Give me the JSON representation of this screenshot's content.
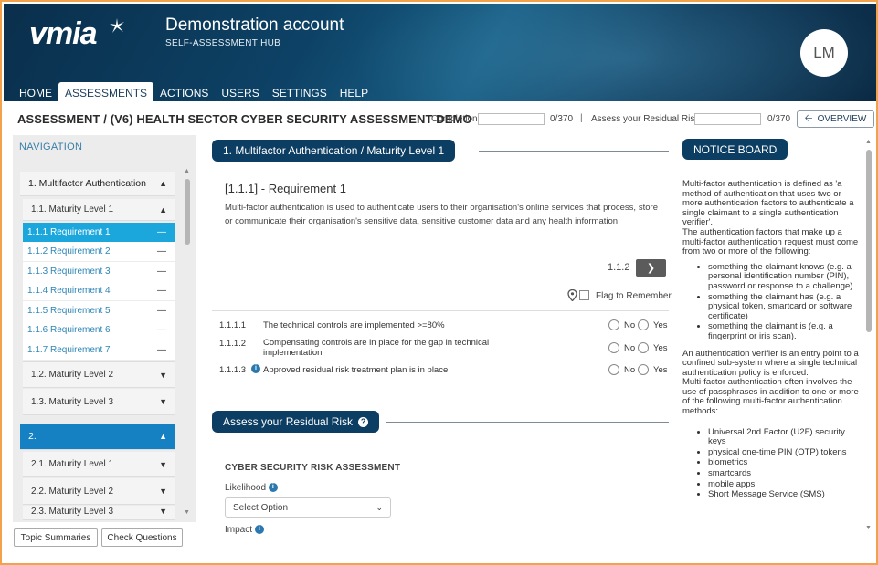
{
  "header": {
    "logo_text": "vmia",
    "title": "Demonstration account",
    "subtitle": "SELF-ASSESSMENT HUB",
    "avatar_initials": "LM",
    "nav": [
      "HOME",
      "ASSESSMENTS",
      "ACTIONS",
      "USERS",
      "SETTINGS",
      "HELP"
    ],
    "active_nav": "ASSESSMENTS"
  },
  "titlebar": {
    "title": "ASSESSMENT / (V6) HEALTH SECTOR CYBER SECURITY ASSESSMENT DEMO",
    "completion_label": "Completion",
    "completion_count": "0/370",
    "separator": "|",
    "residual_label": "Assess your Residual Risk",
    "residual_count": "0/370",
    "overview_label": "OVERVIEW"
  },
  "sidebar": {
    "heading": "NAVIGATION",
    "section1": {
      "label": "1. Multifactor Authentication"
    },
    "maturity1": {
      "label": "1.1. Maturity Level 1"
    },
    "requirements": [
      {
        "label": "1.1.1 Requirement 1",
        "dash": "—"
      },
      {
        "label": "1.1.2 Requirement 2",
        "dash": "—"
      },
      {
        "label": "1.1.3 Requirement 3",
        "dash": "—"
      },
      {
        "label": "1.1.4 Requirement 4",
        "dash": "—"
      },
      {
        "label": "1.1.5 Requirement 5",
        "dash": "—"
      },
      {
        "label": "1.1.6 Requirement 6",
        "dash": "—"
      },
      {
        "label": "1.1.7 Requirement 7",
        "dash": "—"
      }
    ],
    "maturity2": {
      "label": "1.2. Maturity Level 2"
    },
    "maturity3": {
      "label": "1.3. Maturity Level 3"
    },
    "section2": {
      "label": "2."
    },
    "section2_items": [
      {
        "label": "2.1. Maturity Level 1"
      },
      {
        "label": "2.2. Maturity Level 2"
      },
      {
        "label": "2.3. Maturity Level 3"
      }
    ],
    "topic_summaries_label": "Topic Summaries",
    "check_questions_label": "Check Questions"
  },
  "main": {
    "section_pill": "1. Multifactor Authentication / Maturity Level 1",
    "requirement_title": "[1.1.1] - Requirement 1",
    "requirement_desc": "Multi-factor authentication is used to authenticate users to their organisation's online services that process, store or communicate their organisation's sensitive data, sensitive customer data and any health information.",
    "page_indicator": "1.1.2",
    "flag_label": "Flag to Remember",
    "questions": [
      {
        "num": "1.1.1.1",
        "text": "The technical controls are implemented >=80%",
        "no": "No",
        "yes": "Yes"
      },
      {
        "num": "1.1.1.2",
        "text": "Compensating controls are in place for the gap in technical implementation",
        "no": "No",
        "yes": "Yes"
      },
      {
        "num": "1.1.1.3",
        "text": "Approved residual risk treatment plan is in place",
        "no": "No",
        "yes": "Yes"
      }
    ],
    "residual_pill": "Assess your Residual Risk",
    "csra_heading": "CYBER SECURITY RISK ASSESSMENT",
    "likelihood_label": "Likelihood",
    "select_value": "Select Option",
    "impact_label": "Impact"
  },
  "notice": {
    "heading": "NOTICE BOARD",
    "p1": "Multi-factor authentication is defined as 'a method of authentication that uses two or more authentication factors to authenticate a single claimant to a single authentication verifier'.",
    "p2": "The authentication factors that make up a multi-factor authentication request must come from two or more of the following:",
    "list1": [
      "something the claimant knows (e.g. a personal identification number (PIN), password or response to a challenge)",
      "something the claimant has (e.g. a physical token, smartcard or software certificate)",
      "something the claimant is (e.g. a fingerprint or iris scan)."
    ],
    "p3": "An authentication verifier is an entry point to a confined sub-system where a single technical authentication policy is enforced.",
    "p4": "Multi-factor authentication often involves the use of passphrases in addition to one or more of the following multi-factor authentication methods:",
    "list2": [
      "Universal 2nd Factor (U2F) security keys",
      "physical one-time PIN (OTP) tokens",
      "biometrics",
      "smartcards",
      "mobile apps",
      "Short Message Service (SMS)"
    ]
  },
  "colors": {
    "header_dark": "#0a2f4c",
    "pill_navy": "#0c3d62",
    "active_req": "#1ba6dc",
    "section2_blue": "#1580c2",
    "link_blue": "#2f86b6",
    "frame_orange": "#f2a24a"
  }
}
